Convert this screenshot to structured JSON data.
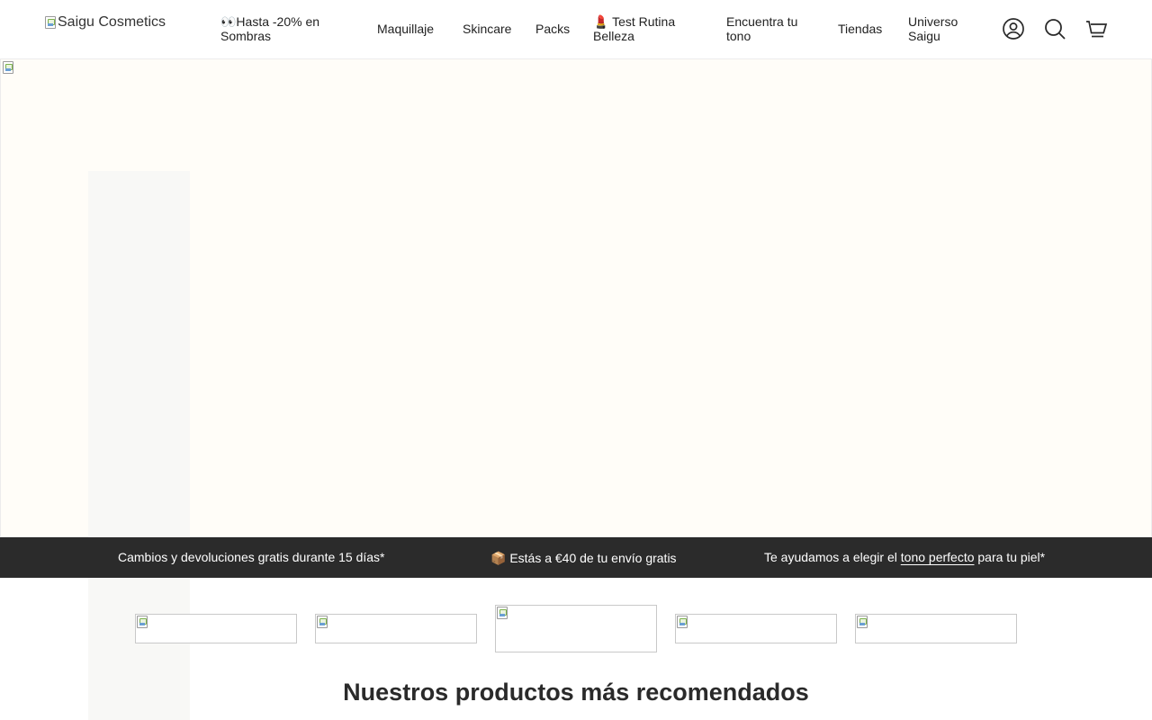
{
  "header": {
    "logo_alt": "Saigu Cosmetics",
    "nav": {
      "promo": "👀Hasta -20% en Sombras",
      "maquillaje": "Maquillaje",
      "skincare": "Skincare",
      "packs": "Packs",
      "test": "💄 Test Rutina Belleza",
      "tono": "Encuentra tu tono",
      "tiendas": "Tiendas",
      "universo": "Universo Saigu"
    },
    "icons": [
      "account-icon",
      "search-icon",
      "cart-icon"
    ]
  },
  "announcement_bar": {
    "item1": "Cambios y devoluciones gratis durante 15 días*",
    "item2": "📦 Estás a €40 de tu envío gratis",
    "item3_pre": "Te ayudamos a elegir el ",
    "item3_link": "tono perfecto",
    "item3_post": " para tu piel*"
  },
  "section": {
    "title": "Nuestros productos más recomendados"
  },
  "colors": {
    "announcement_bg": "#2b2b2b",
    "hero_bg": "#fffdf8",
    "text": "#222222"
  }
}
